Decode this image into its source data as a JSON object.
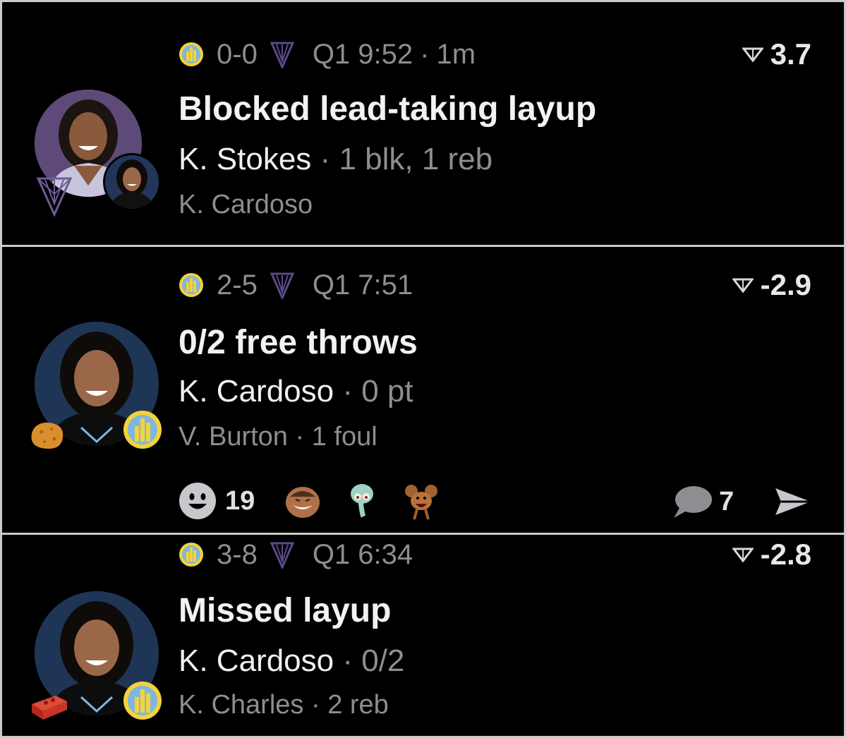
{
  "feed": [
    {
      "score": "0-0",
      "clock": "Q1 9:52",
      "age": "1m",
      "delta": "3.7",
      "headline": "Blocked lead-taking layup",
      "player": "K. Stokes",
      "player_stats": "1 blk, 1 reb",
      "secondary": "K. Cardoso",
      "secondary_stats": "",
      "badge_icon": "lynx-logo-icon"
    },
    {
      "score": "2-5",
      "clock": "Q1 7:51",
      "age": "",
      "delta": "-2.9",
      "headline": "0/2 free throws",
      "player": "K. Cardoso",
      "player_stats": "0 pt",
      "secondary": "V. Burton",
      "secondary_stats": "1 foul",
      "badge_icon": "chicken-nugget-icon",
      "reactions": {
        "smiley_count": "19",
        "emojis": [
          "laughing-man-emoji",
          "squidward-emoji",
          "jerry-mouse-emoji"
        ],
        "comment_count": "7"
      }
    },
    {
      "score": "3-8",
      "clock": "Q1 6:34",
      "age": "",
      "delta": "-2.8",
      "headline": "Missed layup",
      "player": "K. Cardoso",
      "player_stats": "0/2",
      "secondary": "K. Charles",
      "secondary_stats": "2 reb",
      "badge_icon": "brick-icon"
    }
  ],
  "colors": {
    "background": "#000000",
    "muted_text": "#8d8d92",
    "sky_blue": "#7fb6e0",
    "sky_yellow": "#f4d23a",
    "lynx_purple": "#4a3a7a"
  }
}
